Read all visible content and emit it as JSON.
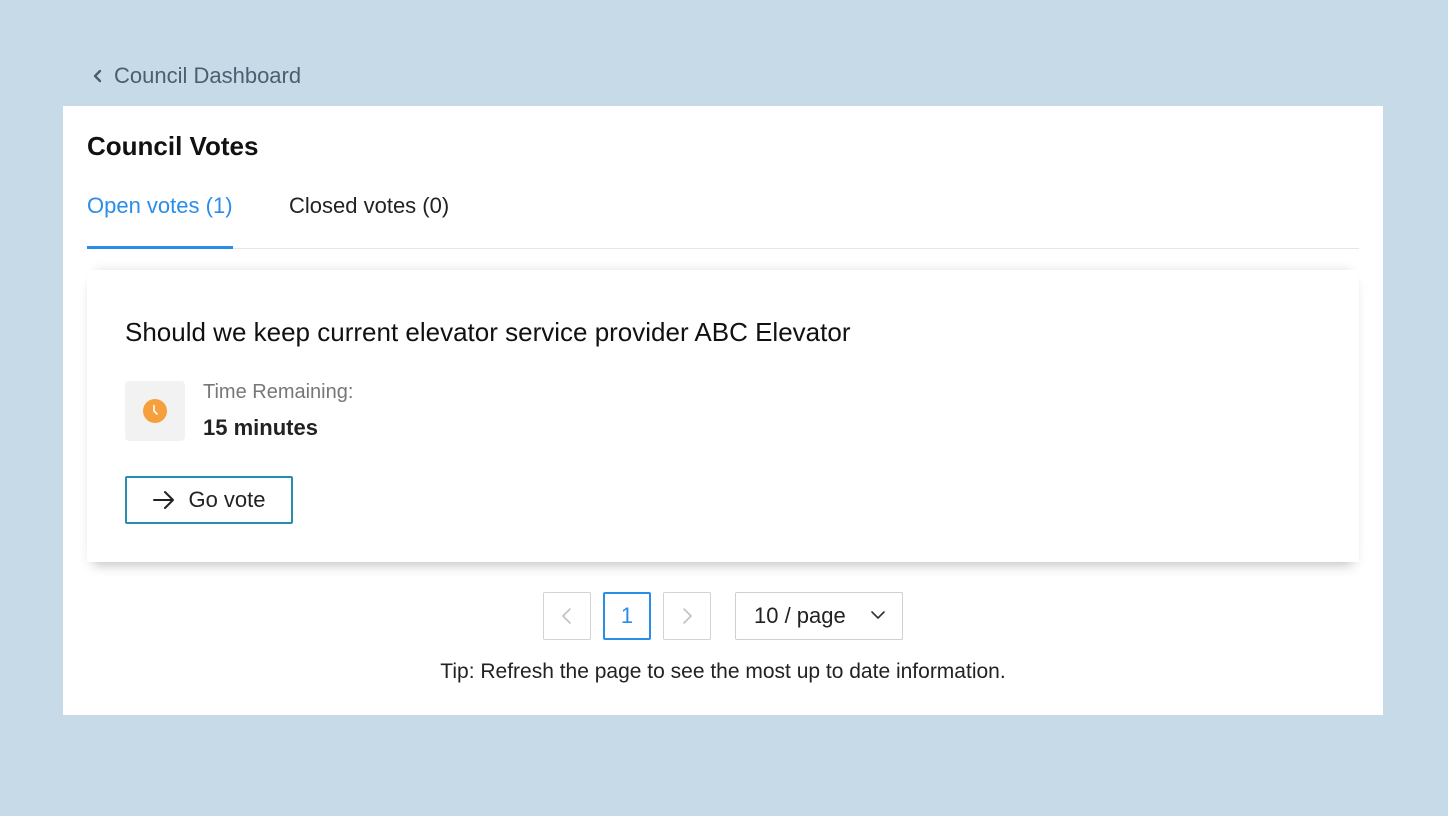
{
  "breadcrumb": {
    "label": "Council Dashboard",
    "icon": "chevron-left-icon"
  },
  "page": {
    "title": "Council Votes"
  },
  "tabs": [
    {
      "label": "Open votes (1)",
      "active": true
    },
    {
      "label": "Closed votes (0)",
      "active": false
    }
  ],
  "votes": [
    {
      "question": "Should we keep current elevator service provider ABC Elevator",
      "time_label": "Time Remaining:",
      "time_value": "15 minutes",
      "icon": "clock-icon",
      "button_label": "Go vote",
      "button_icon": "arrow-right-icon"
    }
  ],
  "pagination": {
    "current_page": "1",
    "page_size": "10 / page",
    "prev_icon": "chevron-left-icon",
    "next_icon": "chevron-right-icon",
    "dropdown_icon": "chevron-down-icon"
  },
  "tip": "Tip: Refresh the page to see the most up to date information.",
  "colors": {
    "background": "#c7dae8",
    "accent": "#2a8ee8",
    "button_border": "#2a8cae",
    "clock": "#f5a03c"
  }
}
